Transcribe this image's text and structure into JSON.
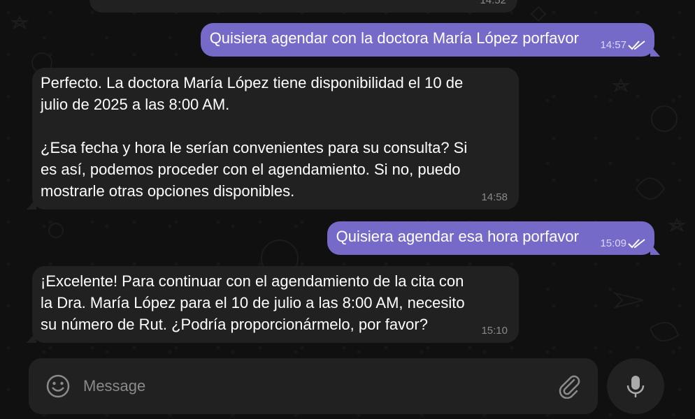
{
  "messages": [
    {
      "direction": "incoming",
      "text": "",
      "time": "14:52"
    },
    {
      "direction": "outgoing",
      "text": "Quisiera agendar con la doctora María López porfavor",
      "time": "14:57"
    },
    {
      "direction": "incoming",
      "text": "Perfecto. La doctora María López tiene disponibilidad el 10 de\njulio de 2025 a las 8:00 AM.\n\n¿Esa fecha y hora le serían convenientes para su consulta? Si\nes así, podemos proceder con el agendamiento. Si no, puedo\nmostrarle otras opciones disponibles.",
      "time": "14:58"
    },
    {
      "direction": "outgoing",
      "text": "Quisiera agendar esa hora porfavor",
      "time": "15:09"
    },
    {
      "direction": "incoming",
      "text": "¡Excelente! Para continuar con el agendamiento de la cita con\nla Dra. María López para el 10 de julio a las 8:00 AM, necesito\nsu número de Rut. ¿Podría proporcionármelo, por favor?",
      "time": "15:10"
    }
  ],
  "composer": {
    "placeholder": "Message",
    "value": ""
  },
  "icons": {
    "emoji": "smiley-face-icon",
    "attach": "paperclip-icon",
    "mic": "microphone-icon",
    "read_receipt": "double-check-icon"
  },
  "colors": {
    "background": "#101010",
    "incoming_bubble": "#212121",
    "outgoing_bubble": "#766ac8",
    "muted_text": "#8a8a8a"
  }
}
